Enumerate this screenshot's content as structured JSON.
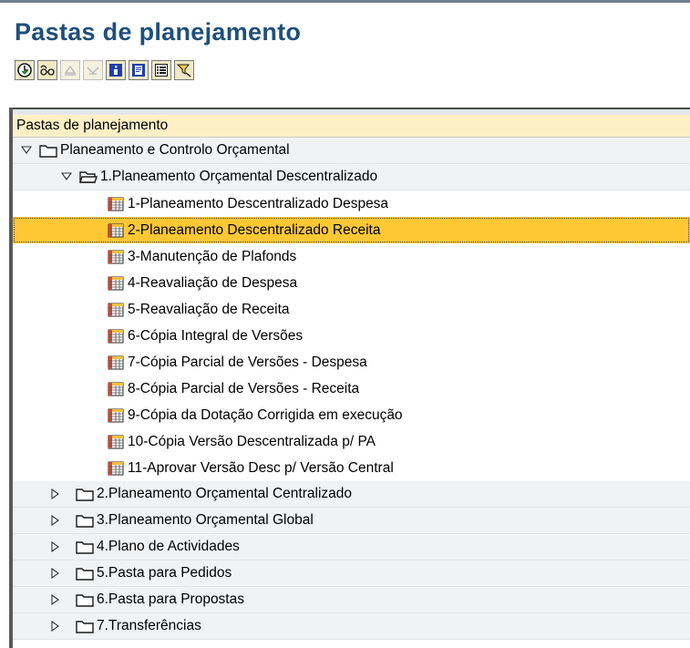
{
  "app": {
    "title": "Pastas de planejamento"
  },
  "toolbar": {
    "buttons": [
      {
        "icon": "execute-icon",
        "enabled": true
      },
      {
        "icon": "glasses-icon",
        "enabled": true
      },
      {
        "icon": "expand-disabled-icon",
        "enabled": false
      },
      {
        "icon": "collapse-disabled-icon",
        "enabled": false
      },
      {
        "icon": "info-icon",
        "enabled": true
      },
      {
        "icon": "document-icon",
        "enabled": true
      },
      {
        "icon": "list-icon",
        "enabled": true
      },
      {
        "icon": "filter-icon",
        "enabled": true
      }
    ]
  },
  "tree": {
    "header": "Pastas de planejamento",
    "root": {
      "label": "Planeamento e Controlo Orçamental",
      "expanded": true
    },
    "group1": {
      "label": "1.Planeamento Orçamental Descentralizado",
      "expanded": true
    },
    "items": [
      "1-Planeamento Descentralizado Despesa",
      "2-Planeamento Descentralizado Receita",
      "3-Manutenção de Plafonds",
      "4-Reavaliação de Despesa",
      "5-Reavaliação de Receita",
      "6-Cópia Integral de Versões",
      "7-Cópia Parcial de Versões - Despesa",
      "8-Cópia Parcial de Versões - Receita",
      "9-Cópia da Dotação Corrigida em execução",
      "10-Cópia Versão Descentralizada p/ PA",
      "11-Aprovar Versão Desc p/ Versão Central"
    ],
    "selected_item": "2-Planeamento Descentralizado Receita",
    "collapsed_folders": [
      "2.Planeamento Orçamental Centralizado",
      "3.Planeamento Orçamental Global",
      "4.Plano de Actividades",
      "5.Pasta para Pedidos",
      "6.Pasta para Propostas",
      "7.Transferências"
    ]
  }
}
